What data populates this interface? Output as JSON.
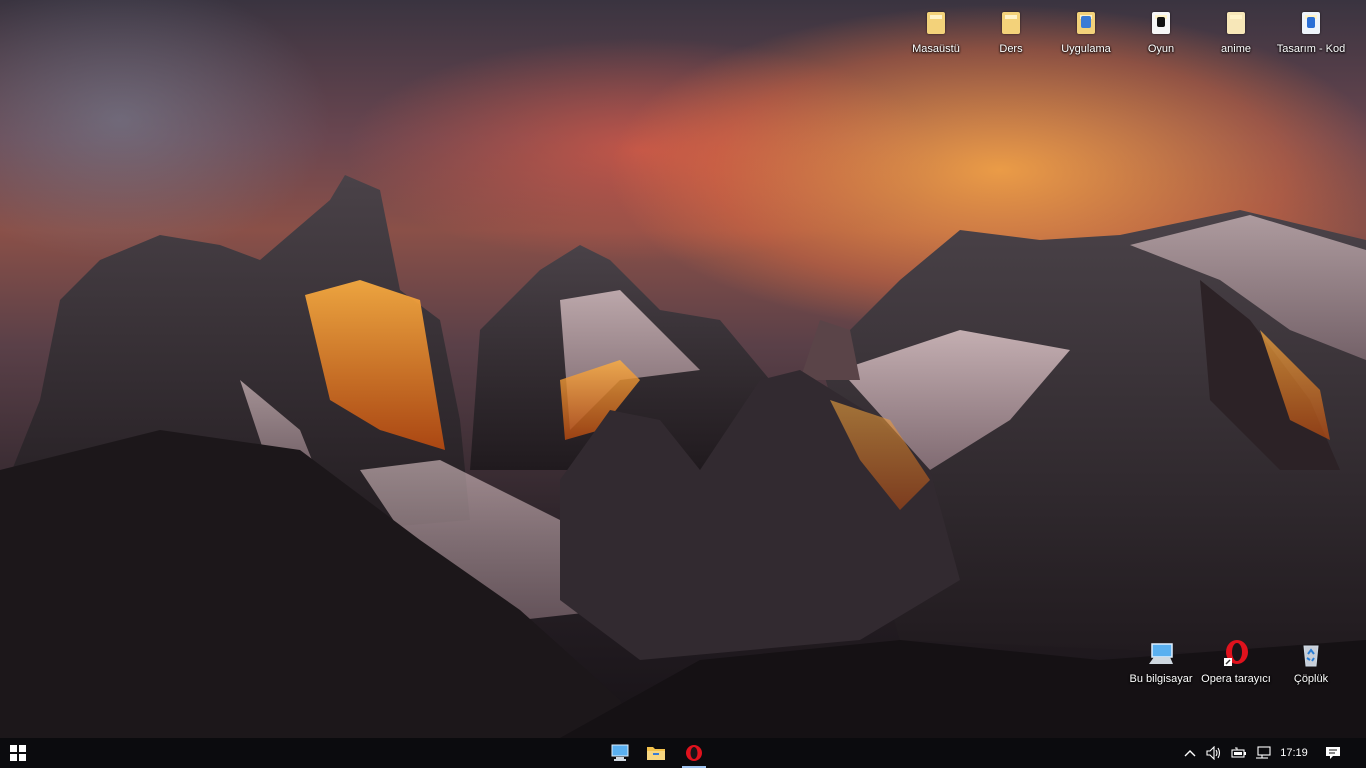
{
  "desktop_icons_top": [
    {
      "label": "Masaüstü",
      "icon": "folder-icon"
    },
    {
      "label": "Ders",
      "icon": "folder-icon"
    },
    {
      "label": "Uygulama",
      "icon": "folder-app-icon"
    },
    {
      "label": "Oyun",
      "icon": "folder-game-icon"
    },
    {
      "label": "anime",
      "icon": "folder-icon"
    },
    {
      "label": "Tasarım - Kod",
      "icon": "folder-code-icon"
    }
  ],
  "desktop_icons_bottom": [
    {
      "label": "Bu bilgisayar",
      "icon": "computer-icon"
    },
    {
      "label": "Opera tarayıcı",
      "icon": "opera-icon"
    },
    {
      "label": "Çöplük",
      "icon": "recycle-bin-icon"
    }
  ],
  "taskbar": {
    "start_icon": "windows-logo-icon",
    "pinned": [
      {
        "name": "this-pc",
        "icon": "computer-icon"
      },
      {
        "name": "file-explorer",
        "icon": "folder-icon"
      },
      {
        "name": "opera",
        "icon": "opera-icon",
        "active": true
      }
    ],
    "tray": {
      "chevron_icon": "chevron-up-icon",
      "volume_icon": "speaker-icon",
      "battery_icon": "battery-icon",
      "network_icon": "network-icon",
      "clock": "17:19",
      "notification_icon": "action-center-icon"
    }
  },
  "colors": {
    "taskbar_bg": "#0a0a0e",
    "opera_red": "#e0121d",
    "folder_yellow": "#f3d27a",
    "active_indicator": "#9fc3f0"
  }
}
